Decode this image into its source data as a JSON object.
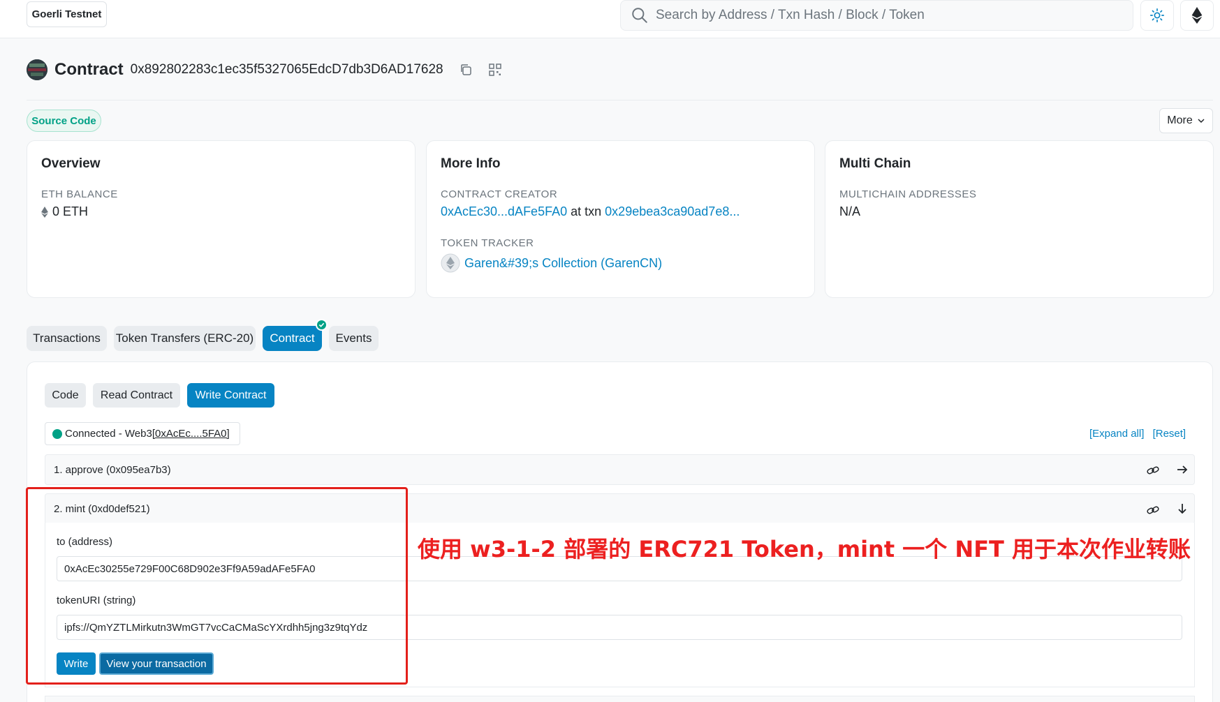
{
  "header": {
    "network": "Goerli Testnet",
    "search_placeholder": "Search by Address / Txn Hash / Block / Token"
  },
  "contract": {
    "title": "Contract",
    "address": "0x892802283c1ec35f5327065EdcD7db3D6AD17628"
  },
  "badges": {
    "source_code": "Source Code",
    "more": "More"
  },
  "overview": {
    "title": "Overview",
    "eth_balance_label": "ETH BALANCE",
    "eth_balance_value": "0 ETH"
  },
  "more_info": {
    "title": "More Info",
    "creator_label": "CONTRACT CREATOR",
    "creator_address": "0xAcEc30...dAFe5FA0",
    "at_txn": "at txn",
    "creator_txn": "0x29ebea3ca90ad7e8...",
    "token_tracker_label": "TOKEN TRACKER",
    "token_tracker_value": "Garen&#39;s Collection (GarenCN)"
  },
  "multi_chain": {
    "title": "Multi Chain",
    "label": "MULTICHAIN ADDRESSES",
    "value": "N/A"
  },
  "tabs": [
    "Transactions",
    "Token Transfers (ERC-20)",
    "Contract",
    "Events"
  ],
  "subtabs": [
    "Code",
    "Read Contract",
    "Write Contract"
  ],
  "connection": {
    "status_prefix": "Connected - Web3 ",
    "address": "[0xAcEc....5FA0]",
    "expand_all": "[Expand all]",
    "reset": "[Reset]"
  },
  "functions": [
    {
      "label": "1. approve (0x095ea7b3)"
    },
    {
      "label": "2. mint (0xd0def521)"
    }
  ],
  "mint_form": {
    "to_label": "to (address)",
    "to_value": "0xAcEc30255e729F00C68D902e3Ff9A59adAFe5FA0",
    "uri_label": "tokenURI (string)",
    "uri_value": "ipfs://QmYZTLMirkutn3WmGT7vcCaCMaScYXrdhh5jng3z9tqYdz",
    "write_label": "Write",
    "view_label": "View your transaction"
  },
  "annotation": "使用 w3-1-2 部署的 ERC721 Token，mint 一个 NFT 用于本次作业转账",
  "colors": {
    "accent": "#0784c3",
    "success": "#00a186",
    "annotation_red": "#e3201b"
  }
}
